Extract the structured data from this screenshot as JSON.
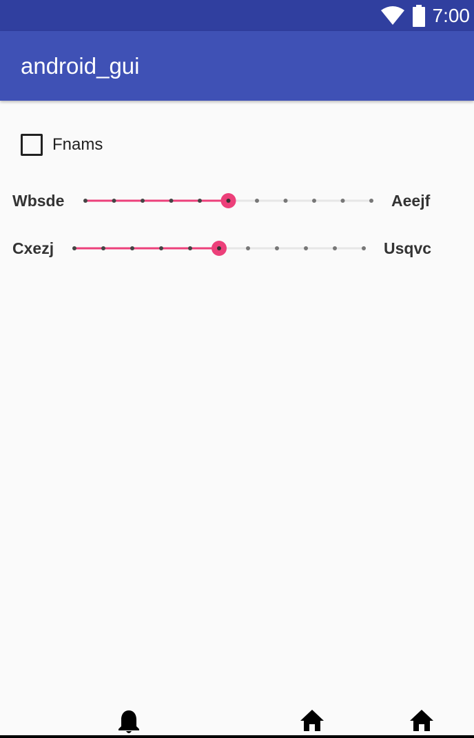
{
  "status_bar": {
    "time": "7:00",
    "icons": [
      "wifi-icon",
      "battery-icon"
    ],
    "background": "#303f9f"
  },
  "app_bar": {
    "title": "android_gui",
    "background": "#3f51b5"
  },
  "checkbox": {
    "label": "Fnams",
    "checked": false
  },
  "sliders": [
    {
      "min_label": "Wbsde",
      "max_label": "Aeejf",
      "steps": 10,
      "value_step": 5,
      "accent": "#ec407a"
    },
    {
      "min_label": "Cxezj",
      "max_label": "Usqvc",
      "steps": 10,
      "value_step": 5,
      "accent": "#ec407a"
    }
  ],
  "nav_bar": {
    "icons": [
      "bell-icon",
      "home-icon",
      "home-icon"
    ]
  }
}
